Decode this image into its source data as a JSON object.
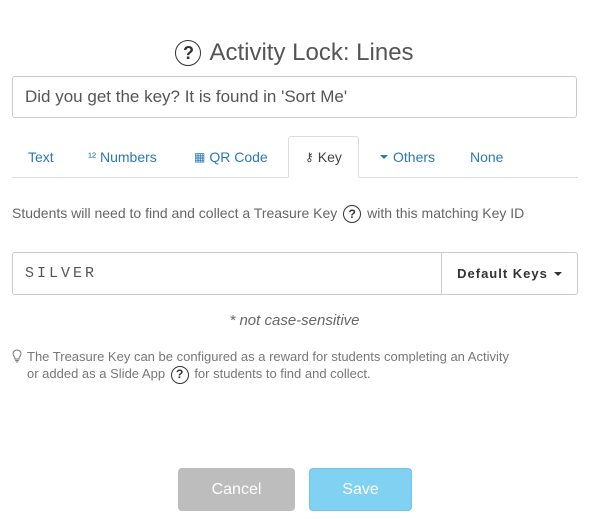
{
  "dialog": {
    "title": "Activity Lock: Lines",
    "help_symbol": "?"
  },
  "prompt": {
    "value": "Did you get the key? It is found in 'Sort Me'"
  },
  "tabs": [
    {
      "label": "Text",
      "glyph": ""
    },
    {
      "label": "Numbers",
      "glyph": "¹²"
    },
    {
      "label": "QR Code",
      "glyph": "▦"
    },
    {
      "label": "Key",
      "glyph": "⚷"
    },
    {
      "label": "Others",
      "glyph": ""
    },
    {
      "label": "None",
      "glyph": ""
    }
  ],
  "active_tab": "Key",
  "key_panel": {
    "instruction_part1": "Students will need to find and collect a Treasure Key",
    "instruction_part2": "with this matching Key ID",
    "key_value": "SILVER",
    "default_keys_label": "Default Keys",
    "case_note": "* not case-sensitive",
    "tip_part1": "The Treasure Key can be configured as a reward for students completing an Activity",
    "tip_part2": "or added as a Slide App",
    "tip_part3": "for students to find and collect."
  },
  "footer": {
    "cancel_label": "Cancel",
    "save_label": "Save"
  },
  "colors": {
    "link": "#2a78b8",
    "save_bg": "#80d1f2",
    "cancel_bg": "#bdbdbd"
  }
}
